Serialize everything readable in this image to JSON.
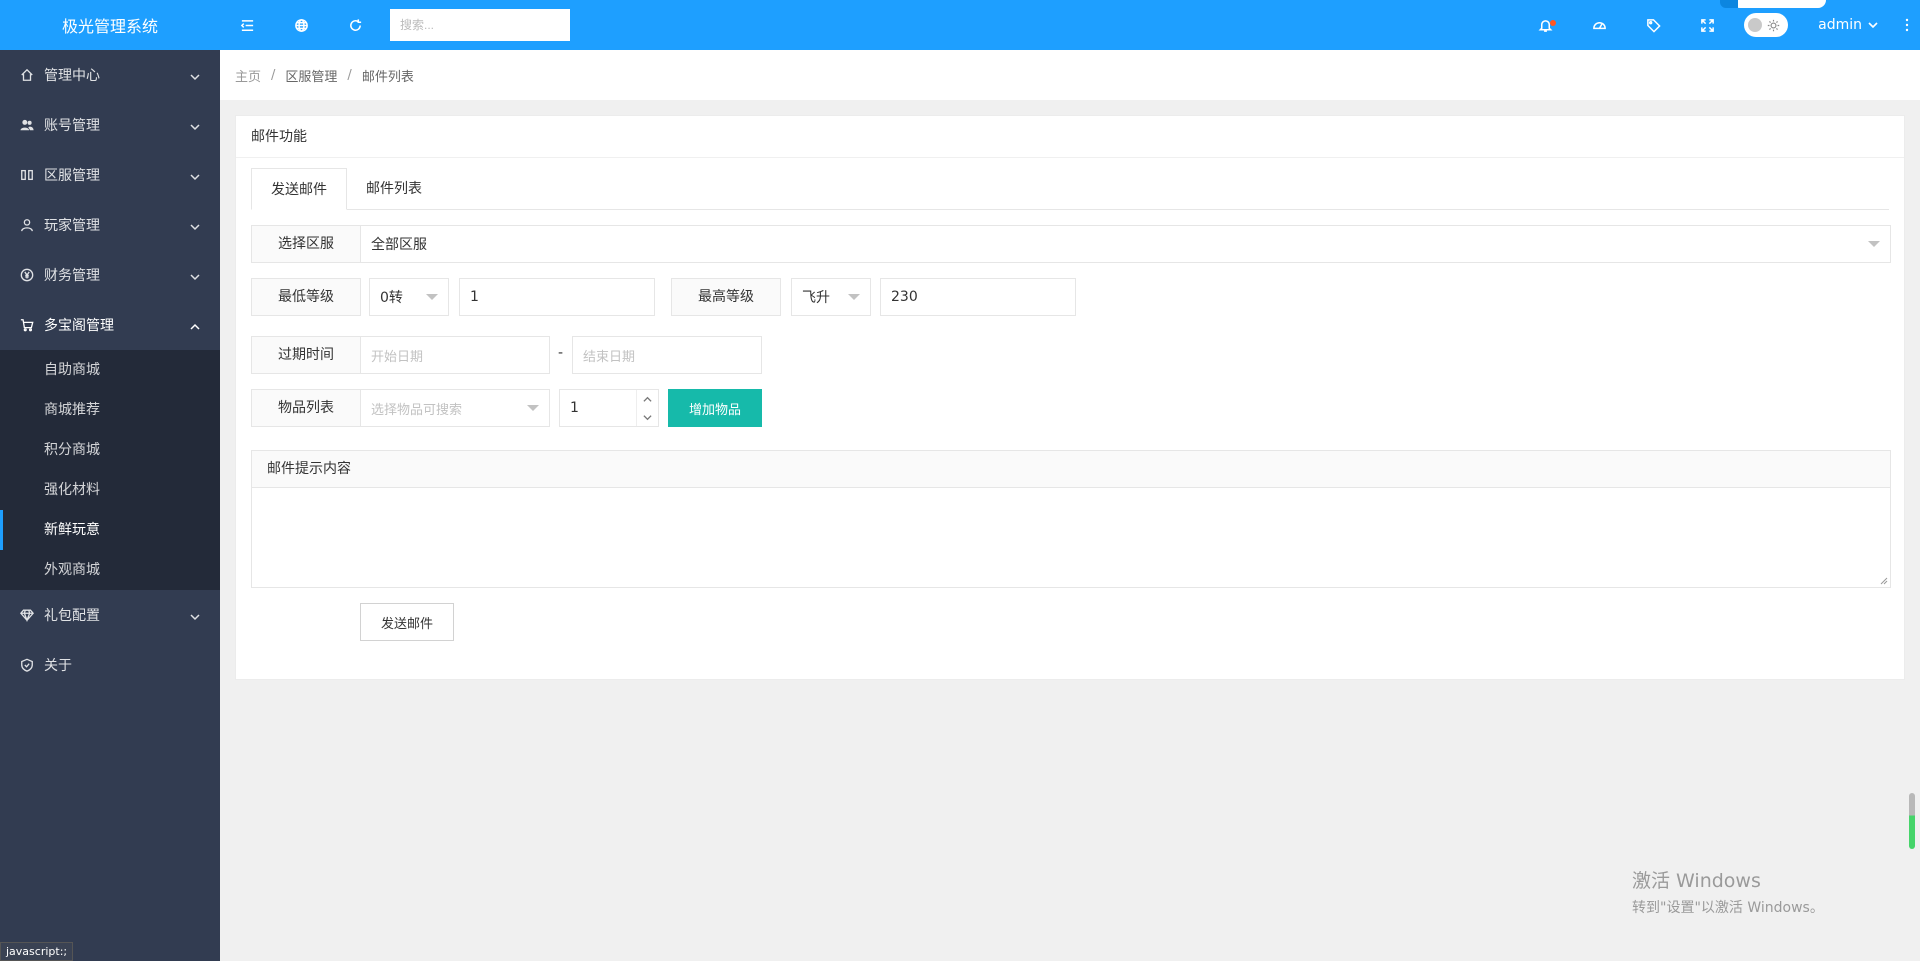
{
  "app": {
    "title": "极光管理系统"
  },
  "header": {
    "search_placeholder": "搜索...",
    "user": "admin"
  },
  "sidebar": {
    "items": [
      {
        "label": "管理中心",
        "icon": "home-icon"
      },
      {
        "label": "账号管理",
        "icon": "users-icon"
      },
      {
        "label": "区服管理",
        "icon": "columns-icon"
      },
      {
        "label": "玩家管理",
        "icon": "user-icon"
      },
      {
        "label": "财务管理",
        "icon": "yen-icon"
      },
      {
        "label": "多宝阁管理",
        "icon": "cart-icon"
      }
    ],
    "sub_items": [
      "自助商城",
      "商城推荐",
      "积分商城",
      "强化材料",
      "新鲜玩意",
      "外观商城"
    ],
    "bottom_items": [
      {
        "label": "礼包配置",
        "icon": "diamond-icon"
      },
      {
        "label": "关于",
        "icon": "shield-check-icon"
      }
    ]
  },
  "breadcrumb": {
    "home": "主页",
    "section": "区服管理",
    "current": "邮件列表",
    "sep": "/"
  },
  "card": {
    "title": "邮件功能"
  },
  "tabs": [
    "发送邮件",
    "邮件列表"
  ],
  "form": {
    "server_label": "选择区服",
    "server_value": "全部区服",
    "min_level_label": "最低等级",
    "min_rebirth": "0转",
    "min_level": "1",
    "max_level_label": "最高等级",
    "max_rebirth": "飞升",
    "max_level": "230",
    "expire_label": "过期时间",
    "start_placeholder": "开始日期",
    "date_sep": "-",
    "end_placeholder": "结束日期",
    "items_label": "物品列表",
    "items_placeholder": "选择物品可搜索",
    "quantity": "1",
    "add_item_button": "增加物品",
    "content_label": "邮件提示内容",
    "send_button": "发送邮件"
  },
  "status_tip": "javascript:;",
  "watermark": {
    "line1": "激活 Windows",
    "line2": "转到\"设置\"以激活 Windows。"
  },
  "colors": {
    "primary": "#1e9fff",
    "sidebar": "#323c51",
    "submenu": "#232a39",
    "teal_button": "#16baaa"
  }
}
